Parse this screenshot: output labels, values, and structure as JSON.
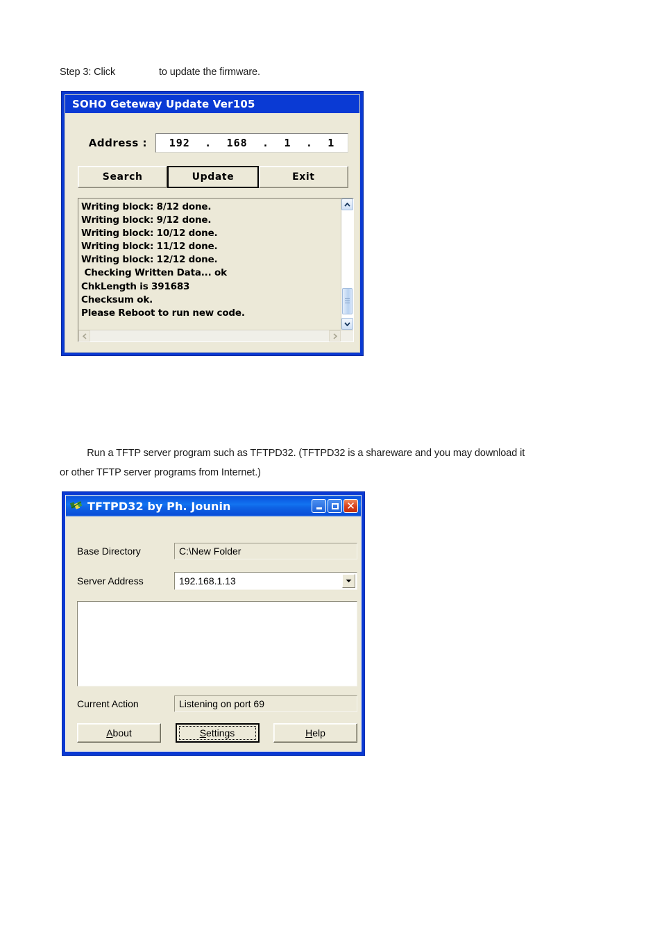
{
  "document": {
    "step3_text": "Step 3: Click                to update the firmware.",
    "paragraph_line_1": "          Run a TFTP server program such as TFTPD32. (TFTPD32 is a shareware and you may download it",
    "paragraph_line_2": "or other TFTP server programs from Internet.)"
  },
  "soho_dialog": {
    "title": "SOHO Geteway Update Ver105",
    "address_label": "Address :",
    "address_value": "192 . 168 .  1  .  1",
    "address_octets": [
      "192",
      "168",
      "1",
      "1"
    ],
    "buttons": [
      {
        "label": "Search",
        "default": false
      },
      {
        "label": "Update",
        "default": true
      },
      {
        "label": "Exit",
        "default": false
      }
    ],
    "log_lines": [
      "Writing block: 8/12 done.",
      "Writing block: 9/12 done.",
      "Writing block: 10/12 done.",
      "Writing block: 11/12 done.",
      "Writing block: 12/12 done.",
      " Checking Written Data... ok",
      "ChkLength is 391683",
      "Checksum ok.",
      "Please Reboot to run new code."
    ],
    "scrollbar": {
      "up_arrow": "▲",
      "down_arrow": "▼",
      "left_arrow": "◀",
      "right_arrow": "▶"
    },
    "colors": {
      "titlebar": "#0a3ad4",
      "face": "#ece9d8",
      "frame": "#0a39d2"
    }
  },
  "tftp_dialog": {
    "title": "TFTPD32 by Ph. Jounin",
    "window_buttons": {
      "minimize": "minimize",
      "maximize": "maximize",
      "close": "✕"
    },
    "fields": {
      "base_directory_label": "Base Directory",
      "base_directory_value": "C:\\New Folder",
      "server_address_label": "Server Address",
      "server_address_value": "192.168.1.13",
      "combo_arrow": "▼",
      "current_action_label": "Current Action",
      "current_action_value": "Listening on port 69"
    },
    "buttons": [
      {
        "accel": "A",
        "rest": "bout",
        "focused": false
      },
      {
        "accel": "S",
        "rest": "ettings",
        "focused": true
      },
      {
        "accel": "H",
        "rest": "elp",
        "focused": false
      }
    ],
    "colors": {
      "titlebar_start": "#1c63d8",
      "titlebar_end": "#0a4fd8",
      "face": "#ece9d8",
      "close_button": "#d8401a",
      "frame": "#0a39d2"
    }
  }
}
